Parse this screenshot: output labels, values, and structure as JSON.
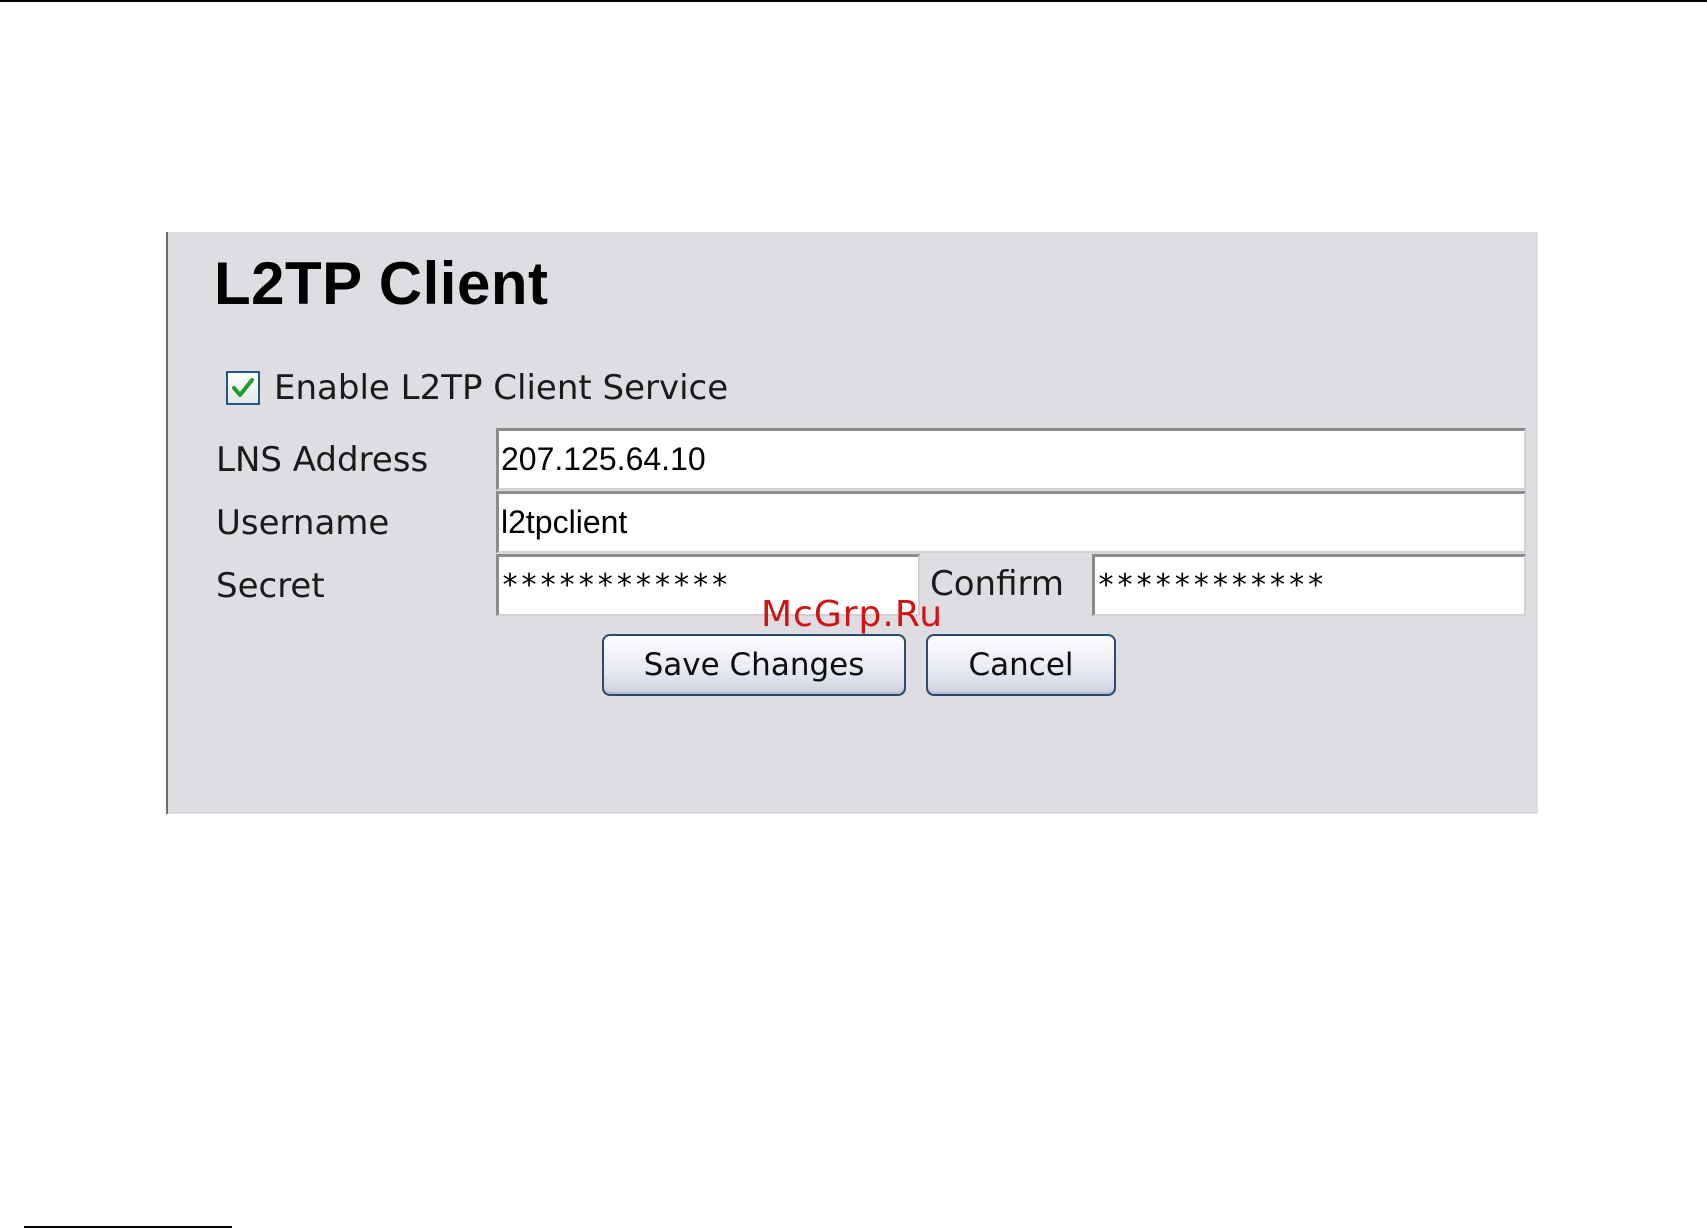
{
  "panel": {
    "title": "L2TP Client",
    "enable": {
      "label": "Enable L2TP Client Service",
      "checked": true
    },
    "fields": {
      "lns_address": {
        "label": "LNS Address",
        "value": "207.125.64.10"
      },
      "username": {
        "label": "Username",
        "value": "l2tpclient"
      },
      "secret": {
        "label": "Secret",
        "value": "************"
      },
      "confirm": {
        "label": "Confirm",
        "value": "************"
      }
    },
    "buttons": {
      "save": "Save Changes",
      "cancel": "Cancel"
    }
  },
  "watermark": "McGrp.Ru",
  "colors": {
    "panel_background": "#dedde2",
    "checkbox_border": "#1e5690",
    "checkmark": "#1c9c2c",
    "button_border": "#2b4a6f",
    "watermark": "#d11313"
  },
  "icons": {
    "checkbox_mark": "checkmark-icon"
  }
}
